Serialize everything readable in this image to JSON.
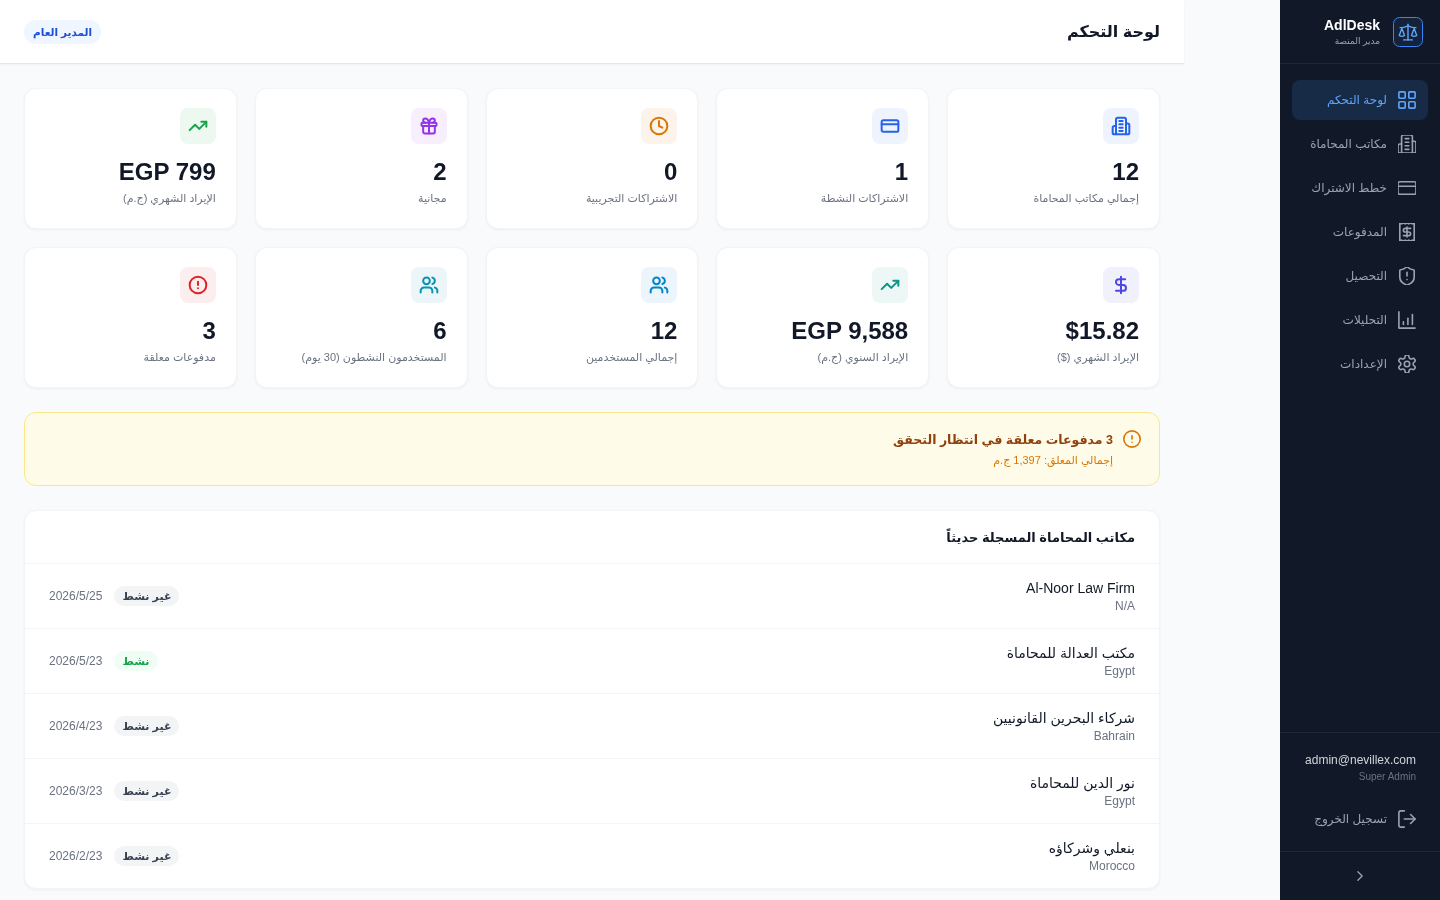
{
  "sidebar": {
    "brand": {
      "name": "AdlDesk",
      "subtitle": "مدير المنصة"
    },
    "nav": [
      {
        "label": "لوحة التحكم",
        "selected": true
      },
      {
        "label": "مكاتب المحاماة",
        "selected": false
      },
      {
        "label": "خطط الاشتراك",
        "selected": false
      },
      {
        "label": "المدفوعات",
        "selected": false
      },
      {
        "label": "التحصيل",
        "selected": false
      },
      {
        "label": "التحليلات",
        "selected": false
      },
      {
        "label": "الإعدادات",
        "selected": false
      }
    ],
    "user": {
      "email": "admin@nevillex.com",
      "role": "Super Admin"
    },
    "logout": "تسجيل الخروج"
  },
  "header": {
    "title": "لوحة التحكم",
    "role_badge": "المدير العام"
  },
  "stats": [
    {
      "value": "12",
      "label": "إجمالي مكاتب المحاماة",
      "color": "#2563eb"
    },
    {
      "value": "1",
      "label": "الاشتراكات النشطة",
      "color": "#2563eb"
    },
    {
      "value": "0",
      "label": "الاشتراكات التجريبية",
      "color": "#d97706"
    },
    {
      "value": "2",
      "label": "مجانية",
      "color": "#9333ea"
    },
    {
      "value": "EGP 799",
      "label": "الإيراد الشهري (ج.م)",
      "color": "#16a34a"
    },
    {
      "value": "$15.82",
      "label": "الإيراد الشهري ($)",
      "color": "#4f46e5"
    },
    {
      "value": "EGP 9,588",
      "label": "الإيراد السنوي (ج.م)",
      "color": "#0d9488"
    },
    {
      "value": "12",
      "label": "إجمالي المستخدمين",
      "color": "#0284c7"
    },
    {
      "value": "6",
      "label": "المستخدمون النشطون (30 يوم)",
      "color": "#0891b2"
    },
    {
      "value": "3",
      "label": "مدفوعات معلقة",
      "color": "#dc2626"
    }
  ],
  "alert": {
    "title": "3 مدفوعات معلقة في انتظار التحقق",
    "subtitle": "إجمالي المعلق: 1,397 ج.م"
  },
  "recent_firms": {
    "title": "مكاتب المحاماة المسجلة حديثاً",
    "rows": [
      {
        "name": "Al-Noor Law Firm",
        "country": "N/A",
        "status": "غير نشط",
        "active": false,
        "date": "2026/5/25"
      },
      {
        "name": "مكتب العدالة للمحاماة",
        "country": "Egypt",
        "status": "نشط",
        "active": true,
        "date": "2026/5/23"
      },
      {
        "name": "شركاء البحرين القانونيين",
        "country": "Bahrain",
        "status": "غير نشط",
        "active": false,
        "date": "2026/4/23"
      },
      {
        "name": "نور الدين للمحاماة",
        "country": "Egypt",
        "status": "غير نشط",
        "active": false,
        "date": "2026/3/23"
      },
      {
        "name": "بنعلي وشركاؤه",
        "country": "Morocco",
        "status": "غير نشط",
        "active": false,
        "date": "2026/2/23"
      }
    ]
  }
}
